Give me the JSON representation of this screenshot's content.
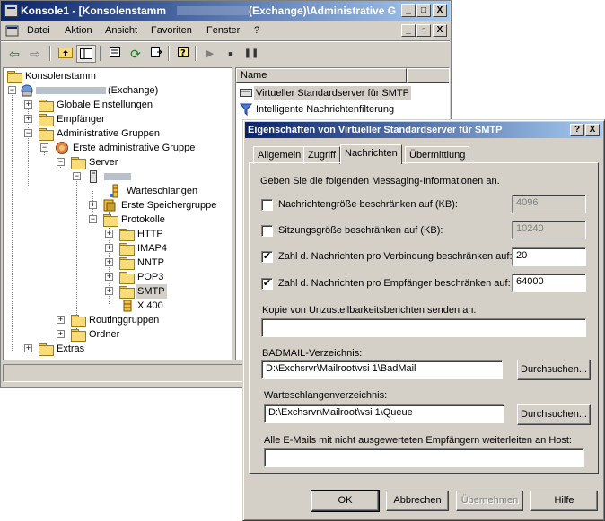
{
  "mmc": {
    "title_left": "Konsole1 - [Konsolenstamm",
    "title_right": "(Exchange)\\Administrative G",
    "caption_buttons": [
      "_",
      "□",
      "X"
    ],
    "child_buttons": [
      "_",
      "▫",
      "X"
    ],
    "menu": [
      "Datei",
      "Aktion",
      "Ansicht",
      "Favoriten",
      "Fenster",
      "?"
    ],
    "toolbar_icons": [
      "back-icon",
      "forward-icon",
      "up-folder-icon",
      "show-tree-icon",
      "properties-icon",
      "refresh-icon",
      "export-list-icon",
      "help-icon",
      "play-icon",
      "stop-icon",
      "pause-icon"
    ],
    "tree": {
      "root": "Konsolenstamm",
      "org_suffix": "(Exchange)",
      "global_settings": "Globale Einstellungen",
      "recipients": "Empfänger",
      "admin_groups": "Administrative Gruppen",
      "first_admin_group": "Erste administrative Gruppe",
      "servers": "Server",
      "queues": "Warteschlangen",
      "first_storage_group": "Erste Speichergruppe",
      "protocols": "Protokolle",
      "http": "HTTP",
      "imap4": "IMAP4",
      "nntp": "NNTP",
      "pop3": "POP3",
      "smtp": "SMTP",
      "x400": "X.400",
      "routing_groups": "Routinggruppen",
      "folders": "Ordner",
      "extras": "Extras"
    },
    "list": {
      "column_name": "Name",
      "items": [
        "Virtueller Standardserver für SMTP",
        "Intelligente Nachrichtenfilterung"
      ]
    }
  },
  "dialog": {
    "title": "Eigenschaften von Virtueller Standardserver für SMTP",
    "title_buttons": [
      "?",
      "X"
    ],
    "tabs": [
      "Allgemein",
      "Zugriff",
      "Nachrichten",
      "Übermittlung"
    ],
    "active_tab": "Nachrichten",
    "intro": "Geben Sie die folgenden Messaging-Informationen an.",
    "limit_size": {
      "label": "Nachrichtengröße beschränken auf (KB):",
      "checked": false,
      "value": "4096"
    },
    "limit_session": {
      "label": "Sitzungsgröße beschränken auf (KB):",
      "checked": false,
      "value": "10240"
    },
    "limit_per_connection": {
      "label": "Zahl d. Nachrichten pro Verbindung beschränken auf:",
      "checked": true,
      "value": "20"
    },
    "limit_per_recipient": {
      "label": "Zahl d. Nachrichten pro Empfänger beschränken auf:",
      "checked": true,
      "value": "64000"
    },
    "ndr_copy_label": "Kopie von Unzustellbarkeitsberichten senden an:",
    "ndr_copy_value": "",
    "badmail_label": "BADMAIL-Verzeichnis:",
    "badmail_value": "D:\\Exchsrvr\\Mailroot\\vsi 1\\BadMail",
    "queue_label": "Warteschlangenverzeichnis:",
    "queue_value": "D:\\Exchsrvr\\Mailroot\\vsi 1\\Queue",
    "forward_label": "Alle E-Mails mit nicht ausgewerteten Empfängern weiterleiten an Host:",
    "forward_value": "",
    "browse_label": "Durchsuchen...",
    "buttons": {
      "ok": "OK",
      "cancel": "Abbrechen",
      "apply": "Übernehmen",
      "help": "Hilfe"
    },
    "check_mark": "✔"
  }
}
